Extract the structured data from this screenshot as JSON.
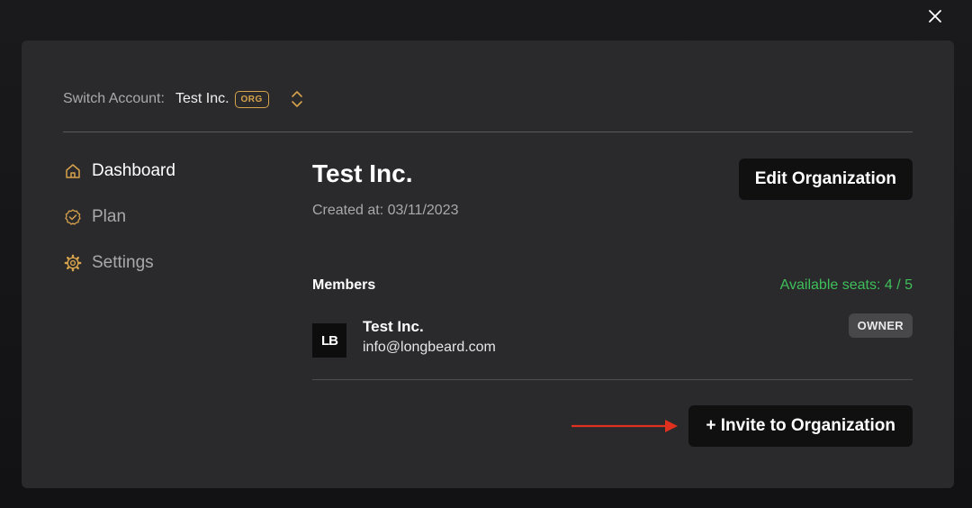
{
  "window": {
    "close_icon": "close-icon"
  },
  "switcher": {
    "label": "Switch Account:",
    "current_account": "Test Inc.",
    "badge": "ORG",
    "icon": "chevron-up-down-icon",
    "accent_color": "#d6a24c"
  },
  "sidebar": {
    "items": [
      {
        "label": "Dashboard",
        "icon": "home-icon",
        "active": true
      },
      {
        "label": "Plan",
        "icon": "badge-check-icon",
        "active": false
      },
      {
        "label": "Settings",
        "icon": "gear-icon",
        "active": false
      }
    ]
  },
  "organization": {
    "name": "Test Inc.",
    "created": "Created at: 03/11/2023",
    "edit_label": "Edit Organization"
  },
  "members": {
    "heading": "Members",
    "seats": "Available seats: 4 / 5",
    "seats_color": "#3fbf5a",
    "list": [
      {
        "avatar_text": "LB",
        "name": "Test Inc.",
        "email": "info@longbeard.com",
        "role": "OWNER"
      }
    ]
  },
  "invite": {
    "label": "+ Invite to Organization",
    "annotation_color": "#e0301e"
  }
}
